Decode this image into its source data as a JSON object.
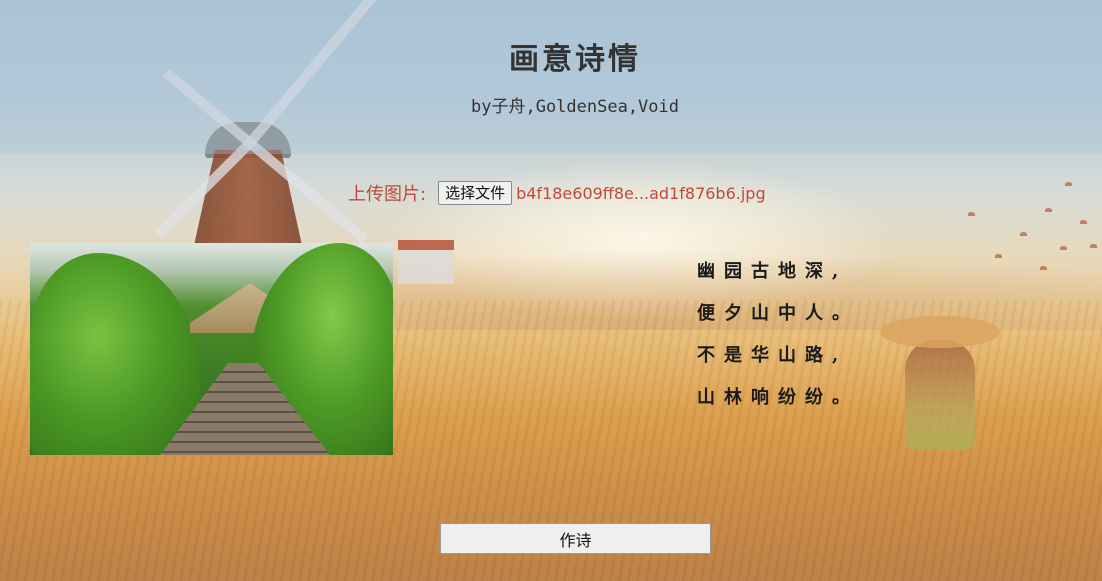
{
  "header": {
    "title": "画意诗情",
    "subtitle": "by子舟,GoldenSea,Void"
  },
  "upload": {
    "label": "上传图片:",
    "choose_file_label": "选择文件",
    "file_name": "b4f18e609ff8e...ad1f876b6.jpg"
  },
  "poem": {
    "lines": [
      "幽园古地深,",
      "便夕山中人。",
      "不是华山路,",
      "山林响纷纷。"
    ]
  },
  "actions": {
    "write_poem_label": "作诗"
  },
  "icons": {
    "photo": "uploaded-photo-boardwalk-garden"
  },
  "colors": {
    "accent_text": "#c04a3a",
    "title_text": "#333333",
    "poem_text": "#1a1a1a"
  }
}
